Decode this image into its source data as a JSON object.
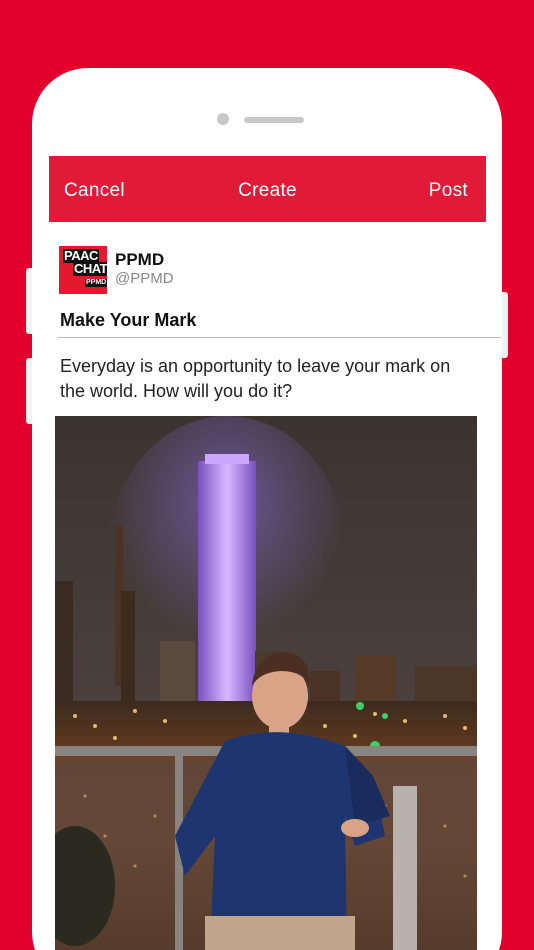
{
  "colors": {
    "background": "#e2002d",
    "navbar": "#e11a37",
    "logo_bg": "#e3192f"
  },
  "nav": {
    "cancel_label": "Cancel",
    "title": "Create",
    "post_label": "Post"
  },
  "account": {
    "logo_text_line1": "PAAC",
    "logo_text_line2": "CHATS",
    "logo_text_line3": "PPMD",
    "name": "PPMD",
    "handle": "@PPMD"
  },
  "post": {
    "title": "Make Your Mark",
    "body": "Everyday is an opportunity to leave your mark on the world. How will you do it?",
    "image_icon": "photo-boy-city-night"
  }
}
